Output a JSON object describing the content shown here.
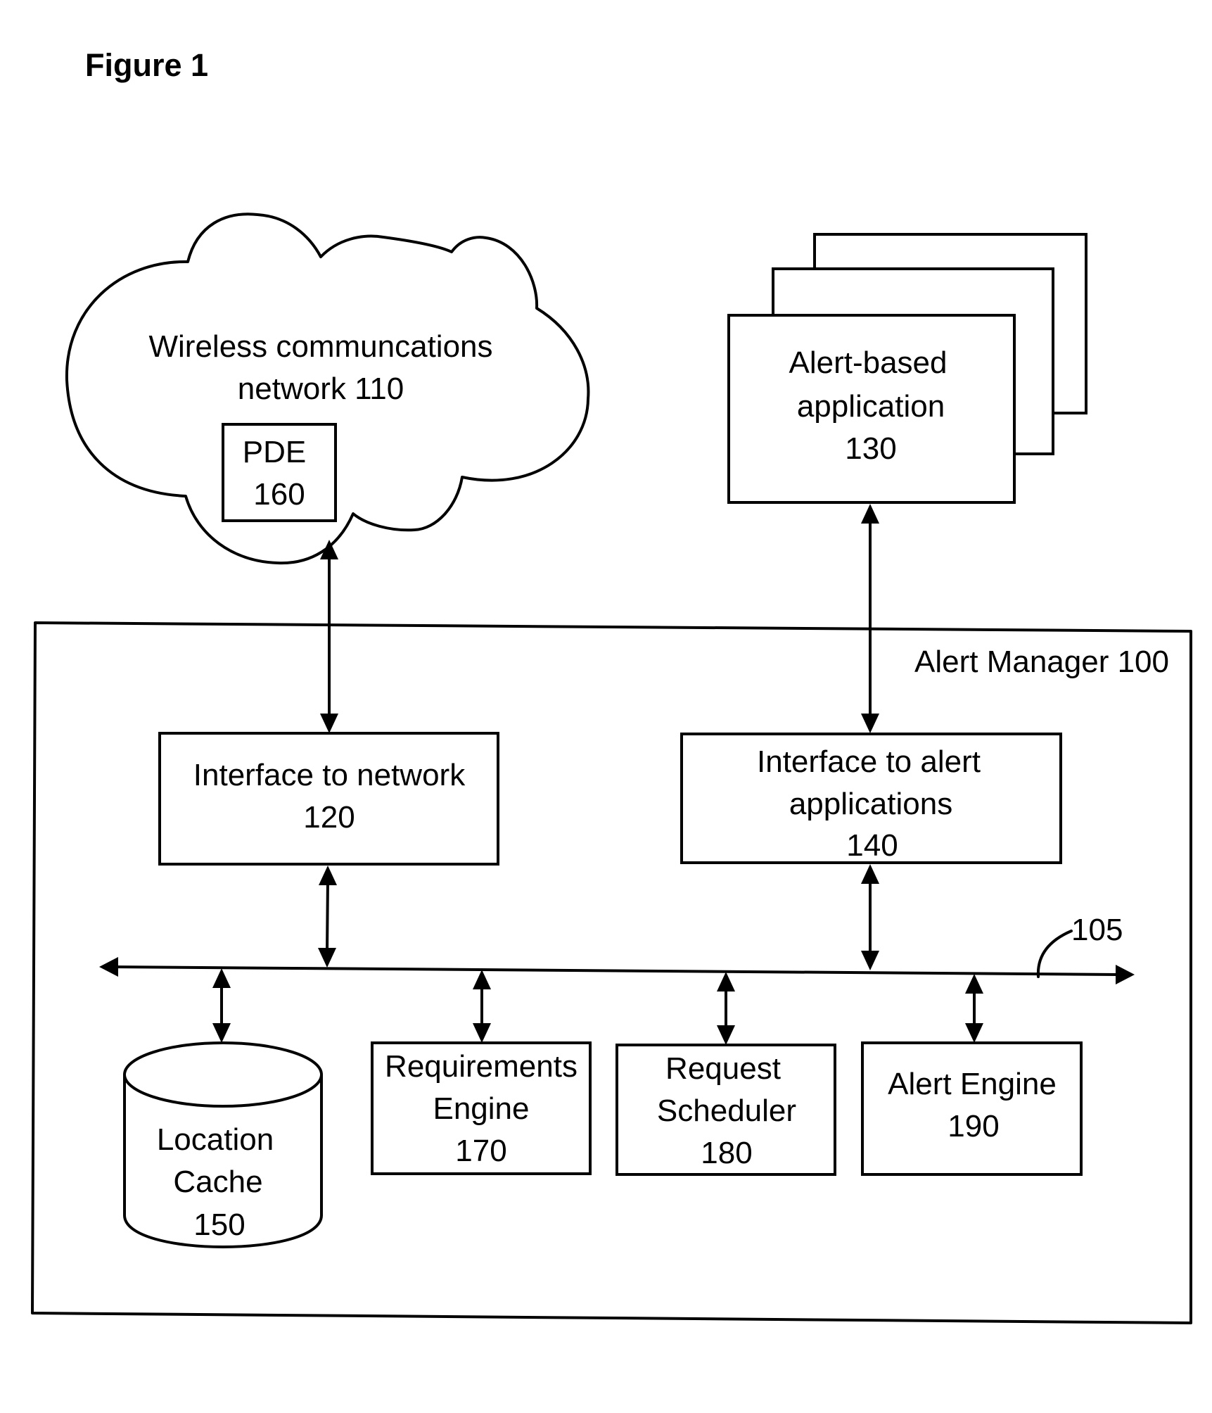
{
  "figure_title": "Figure 1",
  "nodes": {
    "network": {
      "lines": [
        "Wireless communcations",
        "network 110"
      ]
    },
    "pde": {
      "lines": [
        "PDE",
        "160"
      ]
    },
    "alert_app": {
      "lines": [
        "Alert-based",
        "application",
        "130"
      ]
    },
    "alert_manager": {
      "label": "Alert Manager 100"
    },
    "iface_network": {
      "lines": [
        "Interface to network",
        "120"
      ]
    },
    "iface_alert": {
      "lines": [
        "Interface to alert",
        "applications",
        "140"
      ]
    },
    "location_cache": {
      "lines": [
        "Location",
        "Cache",
        "150"
      ]
    },
    "requirements_engine": {
      "lines": [
        "Requirements",
        "Engine",
        "170"
      ]
    },
    "request_scheduler": {
      "lines": [
        "Request",
        "Scheduler",
        "180"
      ]
    },
    "alert_engine": {
      "lines": [
        "Alert Engine",
        "190"
      ]
    }
  },
  "bus": {
    "label": "105"
  },
  "edges": [
    {
      "from": "network",
      "to": "iface_network",
      "type": "bidirectional"
    },
    {
      "from": "alert_app",
      "to": "iface_alert",
      "type": "bidirectional"
    },
    {
      "from": "iface_network",
      "to": "bus",
      "type": "bidirectional"
    },
    {
      "from": "iface_alert",
      "to": "bus",
      "type": "bidirectional"
    },
    {
      "from": "bus",
      "to": "location_cache",
      "type": "bidirectional"
    },
    {
      "from": "bus",
      "to": "requirements_engine",
      "type": "bidirectional"
    },
    {
      "from": "bus",
      "to": "request_scheduler",
      "type": "bidirectional"
    },
    {
      "from": "bus",
      "to": "alert_engine",
      "type": "bidirectional"
    }
  ]
}
